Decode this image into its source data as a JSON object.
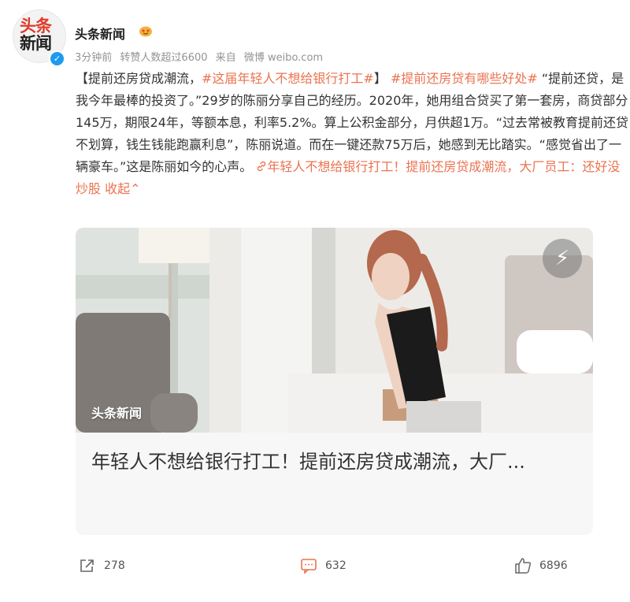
{
  "header": {
    "avatar_text_line1": "头条",
    "avatar_text_line2": "新闻",
    "name": "头条新闻",
    "time": "3分钟前",
    "reposts_info": "转赞人数超过6600",
    "source_label": "来自",
    "source": "微博 weibo.com"
  },
  "post": {
    "part1": "【提前还房贷成潮流，",
    "hashtag1": "#这届年轻人不想给银行打工#",
    "part2": "】",
    "hashtag2": "#提前还房贷有哪些好处#",
    "body": "“提前还贷，是我今年最棒的投资了。”29岁的陈丽分享自己的经历。2020年，她用组合贷买了第一套房，商贷部分145万，期限24年，等额本息，利率5.2%。算上公积金部分，月供超1万。“过去常被教育提前还贷不划算，钱生钱能跑赢利息”，陈丽说道。而在一键还款75万后，她感到无比踏实。“感觉省出了一辆豪车。”这是陈丽如今的心声。",
    "article_link": "年轻人不想给银行打工！提前还房贷成潮流，大厂员工：还好没炒股",
    "collapse_label": "收起"
  },
  "media": {
    "source_watermark": "头条新闻",
    "card_title": "年轻人不想给银行打工！提前还房贷成潮流，大厂..."
  },
  "footer": {
    "reposts": "278",
    "comments": "632",
    "likes": "6896"
  },
  "colors": {
    "accent": "#eb7350",
    "verified": "#1d9bf0"
  }
}
